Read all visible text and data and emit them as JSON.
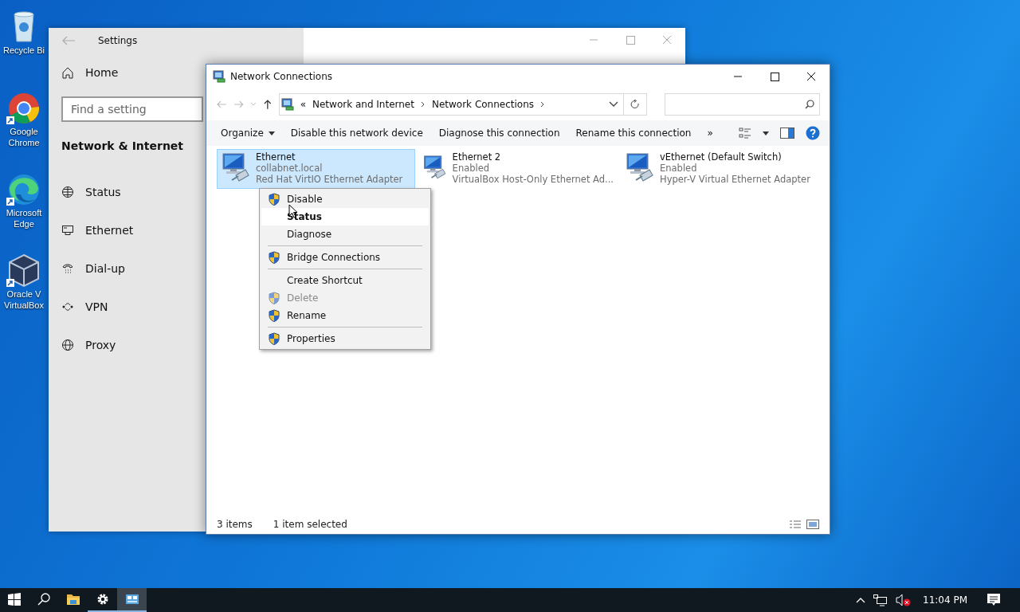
{
  "desktop_icons": [
    {
      "lines": [
        "Recycle Bi"
      ]
    },
    {
      "lines": [
        "Google",
        "Chrome"
      ]
    },
    {
      "lines": [
        "Microsoft",
        "Edge"
      ]
    },
    {
      "lines": [
        "Oracle V",
        "VirtualBox"
      ]
    }
  ],
  "settings_window": {
    "title": "Settings",
    "home": "Home",
    "search": {
      "placeholder": "Find a setting"
    },
    "section": "Network & Internet",
    "nav_items": [
      {
        "label": "Status"
      },
      {
        "label": "Ethernet"
      },
      {
        "label": "Dial-up"
      },
      {
        "label": "VPN"
      },
      {
        "label": "Proxy"
      }
    ]
  },
  "explorer_window": {
    "title": "Network Connections",
    "breadcrumb_overflow": "«",
    "breadcrumb": [
      "Network and Internet",
      "Network Connections"
    ],
    "toolbar": [
      "Organize",
      "Disable this network device",
      "Diagnose this connection",
      "Rename this connection"
    ],
    "toolbar_more": "»",
    "connections": [
      {
        "name": "Ethernet",
        "status": "collabnet.local",
        "adapter": "Red Hat VirtIO Ethernet Adapter",
        "selected": true
      },
      {
        "name": "Ethernet 2",
        "status": "Enabled",
        "adapter": "VirtualBox Host-Only Ethernet Ad...",
        "selected": false
      },
      {
        "name": "vEthernet (Default Switch)",
        "status": "Enabled",
        "adapter": "Hyper-V Virtual Ethernet Adapter",
        "selected": false
      }
    ],
    "status_bar": {
      "count": "3 items",
      "selection": "1 item selected"
    }
  },
  "context_menu": {
    "items": [
      {
        "kind": "item",
        "label": "Disable",
        "shield": true,
        "default": false,
        "selected": false,
        "disabled": false
      },
      {
        "kind": "item",
        "label": "Status",
        "shield": false,
        "default": true,
        "selected": true,
        "disabled": false
      },
      {
        "kind": "item",
        "label": "Diagnose",
        "shield": false,
        "default": false,
        "selected": false,
        "disabled": false
      },
      {
        "kind": "separator"
      },
      {
        "kind": "item",
        "label": "Bridge Connections",
        "shield": true,
        "default": false,
        "selected": false,
        "disabled": false
      },
      {
        "kind": "separator"
      },
      {
        "kind": "item",
        "label": "Create Shortcut",
        "shield": false,
        "default": false,
        "selected": false,
        "disabled": false
      },
      {
        "kind": "item",
        "label": "Delete",
        "shield": true,
        "default": false,
        "selected": false,
        "disabled": true
      },
      {
        "kind": "item",
        "label": "Rename",
        "shield": true,
        "default": false,
        "selected": false,
        "disabled": false
      },
      {
        "kind": "separator"
      },
      {
        "kind": "item",
        "label": "Properties",
        "shield": true,
        "default": false,
        "selected": false,
        "disabled": false
      }
    ]
  },
  "taskbar": {
    "apps": [
      {
        "open": false,
        "selected": false
      },
      {
        "open": false,
        "selected": false
      },
      {
        "open": false,
        "selected": false
      },
      {
        "open": true,
        "selected": false
      },
      {
        "open": true,
        "selected": true
      }
    ],
    "clock": "11:04 PM"
  }
}
